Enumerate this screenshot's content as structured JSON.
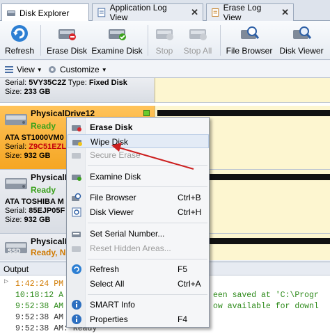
{
  "tabs": [
    {
      "label": "Disk Explorer",
      "icon": "disk-explorer-icon"
    },
    {
      "label": "Application Log View",
      "icon": "log-icon"
    },
    {
      "label": "Erase Log View",
      "icon": "erase-log-icon"
    }
  ],
  "toolbar": {
    "refresh": "Refresh",
    "erase_disk": "Erase Disk",
    "examine_disk": "Examine Disk",
    "stop": "Stop",
    "stop_all": "Stop All",
    "file_browser": "File Browser",
    "disk_viewer": "Disk Viewer"
  },
  "toolbar2": {
    "view": "View",
    "customize": "Customize"
  },
  "disks": [
    {
      "serial_label": "Serial:",
      "serial": "5VY35C2Z",
      "type_label": "Type:",
      "type": "Fixed Disk",
      "size_label": "Size:",
      "size": "233 GB"
    },
    {
      "name": "PhysicalDrive12",
      "status": "Ready",
      "model": "ATA ST1000VM0",
      "serial_label": "Serial:",
      "serial": "Z9C51EZL",
      "size_label": "Size:",
      "size": "932 GB"
    },
    {
      "name": "PhysicalD",
      "status": "Ready",
      "model": "ATA TOSHIBA M",
      "serial_label": "Serial:",
      "serial": "85EJP05F",
      "size_label": "Size:",
      "size": "932 GB"
    },
    {
      "name": "PhysicalD",
      "status": "Ready, No",
      "badge": "SSD"
    }
  ],
  "context_menu": {
    "items": [
      {
        "label": "Erase Disk",
        "shortcut": ""
      },
      {
        "label": "Wipe Disk",
        "shortcut": ""
      },
      {
        "label": "Secure Erase",
        "shortcut": ""
      },
      {
        "label": "Examine Disk",
        "shortcut": ""
      },
      {
        "label": "File Browser",
        "shortcut": "Ctrl+B"
      },
      {
        "label": "Disk Viewer",
        "shortcut": "Ctrl+H"
      },
      {
        "label": "Set Serial Number...",
        "shortcut": ""
      },
      {
        "label": "Reset Hidden Areas...",
        "shortcut": ""
      },
      {
        "label": "Refresh",
        "shortcut": "F5"
      },
      {
        "label": "Select All",
        "shortcut": "Ctrl+A"
      },
      {
        "label": "SMART Info",
        "shortcut": ""
      },
      {
        "label": "Properties",
        "shortcut": "F4"
      }
    ]
  },
  "output": {
    "title": "Output",
    "lines": [
      {
        "text": "1:42:24 PM",
        "tail": ""
      },
      {
        "text": "10:18:12 A",
        "tail": "een saved at 'C:\\Progr"
      },
      {
        "text": "9:52:38 AM",
        "tail": "ow available for downl"
      },
      {
        "text": "9:52:38 AM",
        "tail": ""
      },
      {
        "text": "9:52:38 AM: Ready",
        "tail": ""
      }
    ]
  },
  "colors": {
    "selected_row": "#f5a623",
    "ready_green": "#3aa11c",
    "serial_red": "#c4000b",
    "arrow_red": "#cc1f1f"
  }
}
